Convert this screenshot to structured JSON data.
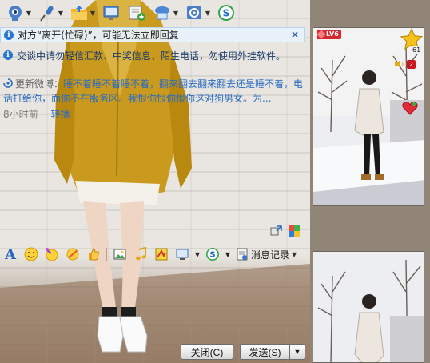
{
  "toolbar": {
    "items": [
      {
        "icon": "video-call-icon"
      },
      {
        "icon": "voice-call-icon"
      },
      {
        "icon": "send-file-icon"
      },
      {
        "icon": "remote-desktop-icon"
      },
      {
        "icon": "create-group-icon"
      },
      {
        "icon": "app-launcher-icon"
      },
      {
        "icon": "settings-icon"
      },
      {
        "icon": "app-s-icon"
      }
    ]
  },
  "notices": {
    "away": "对方“离开(忙碌)”，可能无法立即回复",
    "security": "交谈中请勿轻信汇款、中奖信息、陌生电话，勿使用外挂软件。"
  },
  "status_update": {
    "label": "更新微博：",
    "text": "睡不着睡不着睡不着，翻来翻去翻来翻去还是睡不着，电话打给你，而你不在服务区。我恨你恨你恨你这对狗男女。为...",
    "time": "8小时前",
    "forward": "转播"
  },
  "format_bar": {
    "history_label": "消息记录"
  },
  "buttons": {
    "close": "关闭(C)",
    "send": "发送(S)",
    "send_options": "▼"
  },
  "profile": {
    "level": "LV6",
    "star_count": "61",
    "message_count": "2"
  },
  "colors": {
    "notice_bg": "#e8f3fd",
    "link": "#2a6cc2",
    "level_badge": "#d9272f"
  }
}
